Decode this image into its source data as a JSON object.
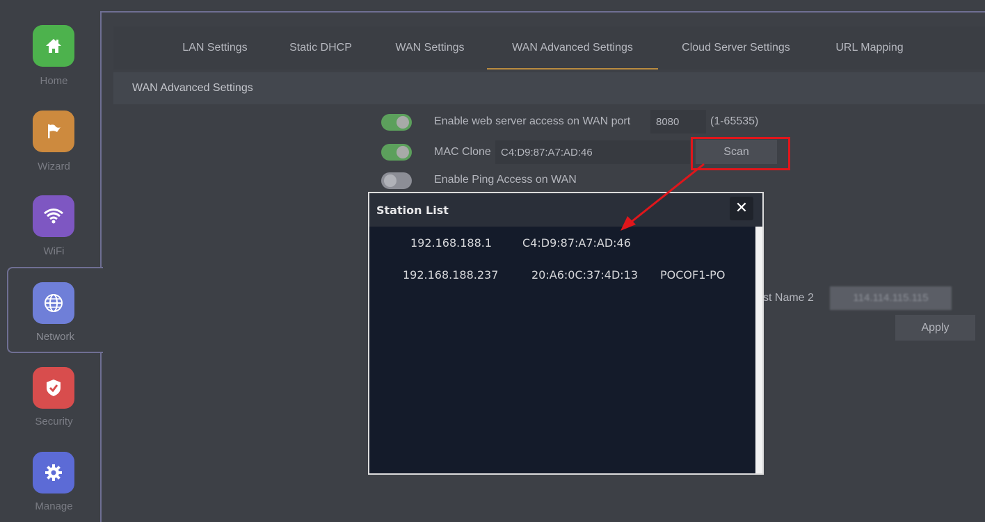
{
  "sidebar": {
    "items": [
      {
        "label": "Home",
        "icon": "home-icon",
        "color": "#4db24d"
      },
      {
        "label": "Wizard",
        "icon": "flag-icon",
        "color": "#cd8a3e"
      },
      {
        "label": "WiFi",
        "icon": "wifi-icon",
        "color": "#7e57c2"
      },
      {
        "label": "Network",
        "icon": "globe-icon",
        "color": "#6f7fd8",
        "active": true
      },
      {
        "label": "Security",
        "icon": "shield-icon",
        "color": "#d84d4d"
      },
      {
        "label": "Manage",
        "icon": "gear-icon",
        "color": "#5c6bd6"
      }
    ]
  },
  "tabs": [
    {
      "label": "LAN Settings"
    },
    {
      "label": "Static DHCP"
    },
    {
      "label": "WAN Settings"
    },
    {
      "label": "WAN Advanced Settings",
      "active": true
    },
    {
      "label": "Cloud Server Settings"
    },
    {
      "label": "URL Mapping"
    }
  ],
  "section": {
    "title": "WAN Advanced Settings"
  },
  "form": {
    "web_access": {
      "label": "Enable web server access on WAN port",
      "enabled": true,
      "port": "8080",
      "range": "(1-65535)"
    },
    "mac_clone": {
      "label": "MAC Clone",
      "enabled": true,
      "value": "C4:D9:87:A7:AD:46",
      "scan_label": "Scan"
    },
    "ping": {
      "label": "Enable Ping Access on WAN",
      "enabled": false
    },
    "host_name_2": {
      "label": "st Name 2",
      "value": "114.114.115.115"
    },
    "apply_label": "Apply"
  },
  "modal": {
    "title": "Station List",
    "close_symbol": "✕",
    "stations": [
      {
        "ip": "192.168.188.1",
        "mac": "C4:D9:87:A7:AD:46",
        "name": ""
      },
      {
        "ip": "192.168.188.237",
        "mac": "20:A6:0C:37:4D:13",
        "name": "POCOF1-PO"
      }
    ]
  },
  "colors": {
    "accent_tab": "#b98b3f",
    "highlight": "#e0161b",
    "toggle_on": "#5ca05c"
  }
}
